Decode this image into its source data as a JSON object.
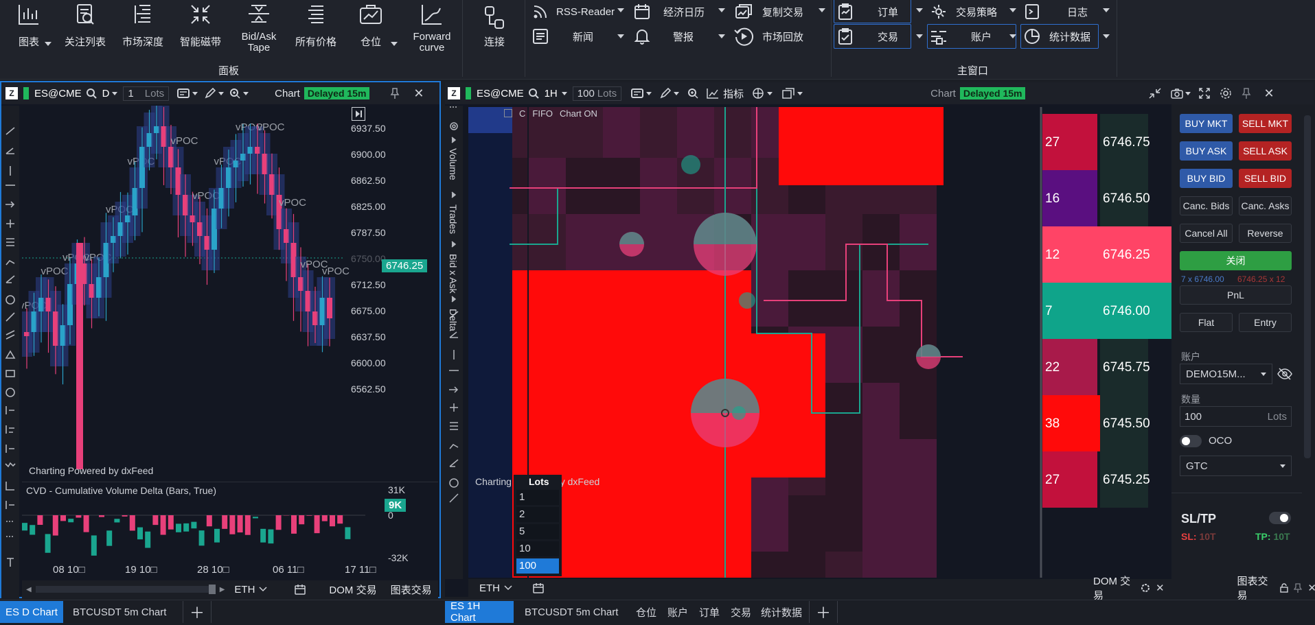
{
  "ribbon": {
    "panel_buttons": [
      {
        "label": "图表",
        "icon": "chart-icon"
      },
      {
        "label": "关注列表",
        "icon": "watchlist-icon"
      },
      {
        "label": "市场深度",
        "icon": "market-depth-icon"
      },
      {
        "label": "智能磁带",
        "icon": "smart-tape-icon"
      },
      {
        "label": "Bid/Ask\nTape",
        "icon": "bid-ask-tape-icon"
      },
      {
        "label": "所有价格",
        "icon": "all-prices-icon"
      },
      {
        "label": "仓位",
        "icon": "positions-icon"
      },
      {
        "label": "Forward\ncurve",
        "icon": "forward-curve-icon"
      }
    ],
    "group_panel": "面板",
    "connect": "连接",
    "small_items": [
      {
        "label": "RSS-Reader",
        "icon": "rss-icon"
      },
      {
        "label": "新闻",
        "icon": "news-icon"
      },
      {
        "label": "经济日历",
        "icon": "calendar-icon"
      },
      {
        "label": "警报",
        "icon": "bell-icon"
      },
      {
        "label": "复制交易",
        "icon": "copy-trade-icon"
      },
      {
        "label": "市场回放",
        "icon": "replay-icon"
      }
    ],
    "main_items": [
      {
        "label": "订单",
        "icon": "orders-icon"
      },
      {
        "label": "交易",
        "icon": "trades-icon"
      },
      {
        "label": "交易策略",
        "icon": "strategy-icon"
      },
      {
        "label": "账户",
        "icon": "account-icon"
      },
      {
        "label": "日志",
        "icon": "log-icon"
      },
      {
        "label": "统计数据",
        "icon": "statistics-icon"
      }
    ],
    "group_main": "主窗口"
  },
  "left_chart": {
    "symbol": "ES@CME",
    "interval": "D",
    "lots_value": "1",
    "lots_label": "Lots",
    "title": "Chart",
    "delayed": "Delayed 15m",
    "price_axis": [
      "6937.50",
      "6900.00",
      "6862.50",
      "6825.00",
      "6787.50",
      "6750.00",
      "6712.50",
      "6675.00",
      "6637.50",
      "6600.00",
      "6562.50"
    ],
    "current_price": "6746.25",
    "poc_label": "vPOC",
    "watermark": "Charting Powered by dxFeed",
    "cvd_title": "CVD - Cumulative Volume Delta (Bars, True)",
    "cvd_axis": [
      "31K",
      "0",
      "-32K"
    ],
    "cvd_value": "9K",
    "dates": [
      "08 10□",
      "19 10□",
      "28 10□",
      "06 11□",
      "17 11□"
    ],
    "bottom": {
      "eth": "ETH",
      "dom": "DOM 交易",
      "chart_trade": "图表交易"
    }
  },
  "right_chart": {
    "symbol": "ES@CME",
    "interval": "1H",
    "lots_value": "100",
    "lots_label": "Lots",
    "indicator": "指标",
    "title": "Chart",
    "delayed": "Delayed 15m",
    "header_flags": [
      "C",
      "FIFO",
      "Chart ON"
    ],
    "side_labels": [
      "Volume",
      "Trades",
      "Bid x Ask",
      "Delta"
    ],
    "ladder": [
      {
        "vol": "27",
        "price": "6746.75"
      },
      {
        "vol": "16",
        "price": "6746.50"
      },
      {
        "vol": "12",
        "price": "6746.25"
      },
      {
        "vol": "7",
        "price": "6746.00"
      },
      {
        "vol": "22",
        "price": "6745.75"
      },
      {
        "vol": "38",
        "price": "6745.50"
      },
      {
        "vol": "27",
        "price": "6745.25"
      }
    ],
    "watermark": "Charting Powered by dxFeed",
    "lots_dropdown": {
      "title": "Lots",
      "options": [
        "1",
        "2",
        "5",
        "10",
        "100"
      ],
      "selected": "100"
    },
    "bottom": {
      "eth": "ETH",
      "dom": "DOM 交易",
      "chart_trade": "图表交易"
    }
  },
  "trade_panel": {
    "buy_mkt": "BUY MKT",
    "sell_mkt": "SELL MKT",
    "buy_ask": "BUY ASK",
    "sell_ask": "SELL ASK",
    "buy_bid": "BUY BID",
    "sell_bid": "SELL BID",
    "canc_bids": "Canc. Bids",
    "canc_asks": "Canc. Asks",
    "cancel_all": "Cancel All",
    "reverse": "Reverse",
    "close": "关闭",
    "pos_buy": "7 x 6746.00",
    "pos_sell": "6746.25 x 12",
    "pnl": "PnL",
    "flat": "Flat",
    "entry": "Entry",
    "account_label": "账户",
    "account": "DEMO15M...",
    "qty_label": "数量",
    "qty": "100",
    "qty_unit": "Lots",
    "oco": "OCO",
    "tif": "GTC",
    "sltp": "SL/TP",
    "sl": "SL:",
    "sl_val": "10T",
    "tp": "TP:",
    "tp_val": "10T"
  },
  "tabs_left": [
    {
      "label": "ES D Chart",
      "active": true
    },
    {
      "label": "BTCUSDT 5m Chart",
      "active": false
    }
  ],
  "tabs_right": [
    {
      "label": "ES 1H Chart",
      "active": true
    },
    {
      "label": "BTCUSDT 5m Chart",
      "active": false
    },
    {
      "label": "仓位"
    },
    {
      "label": "账户"
    },
    {
      "label": "订单"
    },
    {
      "label": "交易"
    },
    {
      "label": "统计数据"
    }
  ],
  "colors": {
    "accent": "#1f7ad8",
    "bull": "#1aa68f",
    "bear": "#e8407a",
    "ladder_red": "#ff0a0a",
    "badge": "#20b85c"
  }
}
